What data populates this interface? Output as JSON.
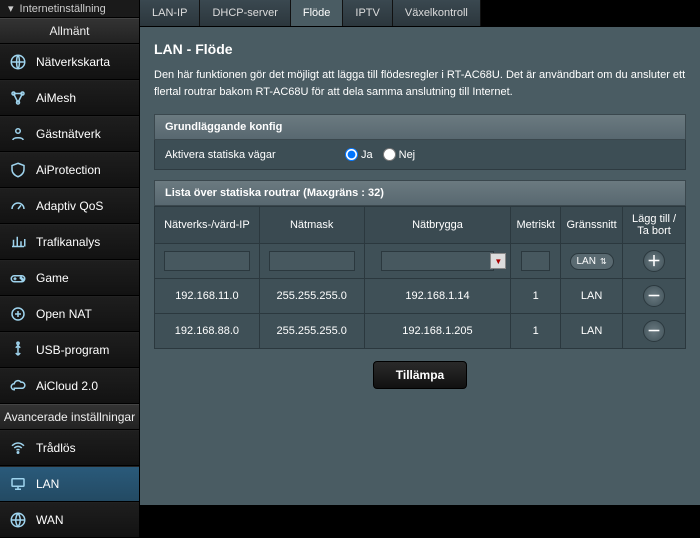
{
  "top_truncated": "Internetinställning",
  "sidebar_general_title": "Allmänt",
  "sidebar_general": [
    {
      "label": "Nätverkskarta",
      "icon": "globe"
    },
    {
      "label": "AiMesh",
      "icon": "mesh"
    },
    {
      "label": "Gästnätverk",
      "icon": "guest"
    },
    {
      "label": "AiProtection",
      "icon": "shield"
    },
    {
      "label": "Adaptiv QoS",
      "icon": "gauge"
    },
    {
      "label": "Trafikanalys",
      "icon": "traffic"
    },
    {
      "label": "Game",
      "icon": "gamepad"
    },
    {
      "label": "Open NAT",
      "icon": "nat"
    },
    {
      "label": "USB-program",
      "icon": "usb"
    },
    {
      "label": "AiCloud 2.0",
      "icon": "cloud"
    }
  ],
  "sidebar_advanced_title": "Avancerade inställningar",
  "sidebar_advanced": [
    {
      "label": "Trådlös",
      "icon": "wifi",
      "active": false
    },
    {
      "label": "LAN",
      "icon": "lan",
      "active": true
    },
    {
      "label": "WAN",
      "icon": "wan",
      "active": false
    }
  ],
  "tabs": [
    {
      "label": "LAN-IP"
    },
    {
      "label": "DHCP-server"
    },
    {
      "label": "Flöde",
      "active": true
    },
    {
      "label": "IPTV"
    },
    {
      "label": "Växelkontroll"
    }
  ],
  "page_title": "LAN - Flöde",
  "page_desc": "Den här funktionen gör det möjligt att lägga till flödesregler i RT-AC68U. Det är användbart om du ansluter ett flertal routrar bakom RT-AC68U för att dela samma anslutning till Internet.",
  "basic_header": "Grundläggande konfig",
  "enable_label": "Aktivera statiska vägar",
  "radio_yes": "Ja",
  "radio_no": "Nej",
  "enable_value": "Ja",
  "list_header": "Lista över statiska routrar (Maxgräns : 32)",
  "th": {
    "ip": "Nätverks-/värd-IP",
    "mask": "Nätmask",
    "gateway": "Nätbrygga",
    "metric": "Metriskt",
    "iface": "Gränssnitt",
    "action": "Lägg till / Ta bort"
  },
  "iface_select": "LAN",
  "rows": [
    {
      "ip": "192.168.11.0",
      "mask": "255.255.255.0",
      "gateway": "192.168.1.14",
      "metric": "1",
      "iface": "LAN"
    },
    {
      "ip": "192.168.88.0",
      "mask": "255.255.255.0",
      "gateway": "192.168.1.205",
      "metric": "1",
      "iface": "LAN"
    }
  ],
  "apply": "Tillämpa"
}
